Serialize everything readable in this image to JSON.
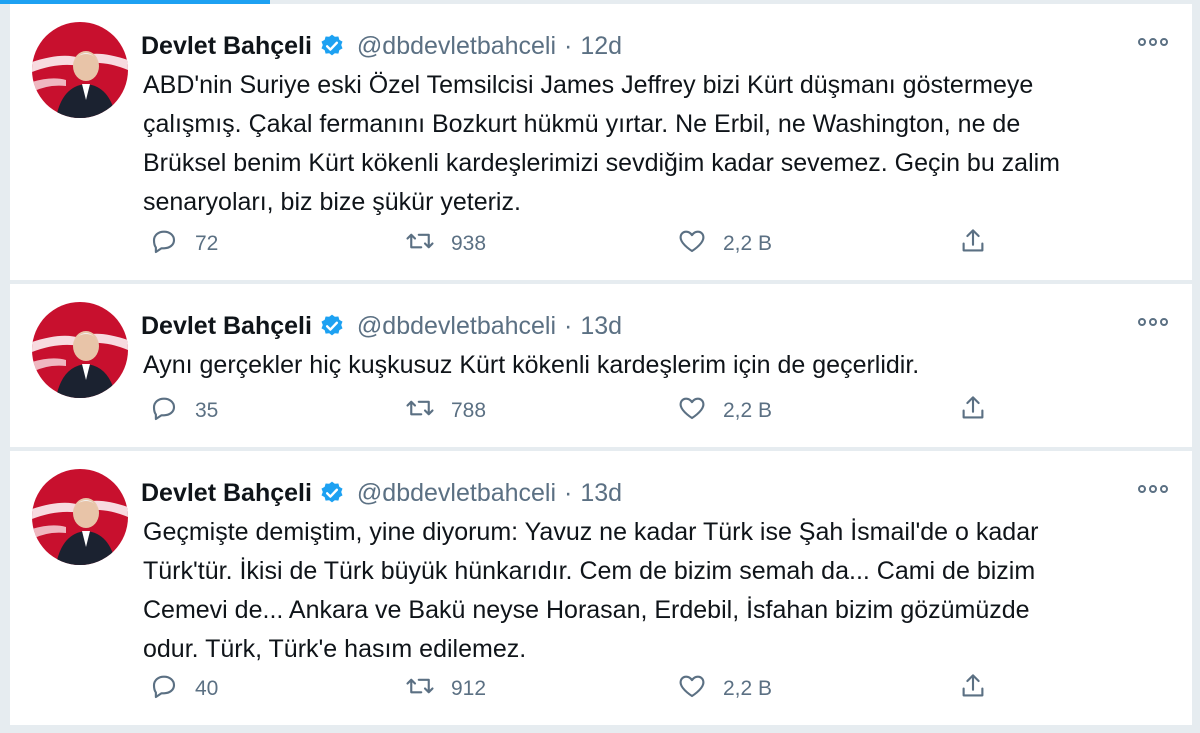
{
  "colors": {
    "accent": "#1da1f2",
    "verified": "#1da1f2",
    "secondary_text": "#5b7083",
    "avatar_bg": "#c8102e"
  },
  "icons": {
    "reply": "reply-icon",
    "retweet": "retweet-icon",
    "like": "heart-icon",
    "share": "share-icon",
    "verified": "verified-badge-icon",
    "more": "more-icon"
  },
  "tweets": [
    {
      "name": "Devlet Bahçeli",
      "handle": "@dbdevletbahceli",
      "dot": "·",
      "time": "12d",
      "text": "ABD'nin Suriye eski Özel Temsilcisi James Jeffrey bizi Kürt düşmanı göstermeye\nçalışmış. Çakal fermanını Bozkurt hükmü yırtar. Ne Erbil, ne Washington, ne de\nBrüksel benim Kürt kökenli kardeşlerimizi sevdiğim kadar sevemez. Geçin bu zalim\nsenaryoları, biz bize şükür yeteriz.",
      "replies": "72",
      "retweets": "938",
      "likes": "2,2 B"
    },
    {
      "name": "Devlet Bahçeli",
      "handle": "@dbdevletbahceli",
      "dot": "·",
      "time": "13d",
      "text": "Aynı gerçekler hiç kuşkusuz Kürt kökenli kardeşlerim için de geçerlidir.",
      "replies": "35",
      "retweets": "788",
      "likes": "2,2 B"
    },
    {
      "name": "Devlet Bahçeli",
      "handle": "@dbdevletbahceli",
      "dot": "·",
      "time": "13d",
      "text": "Geçmişte demiştim, yine diyorum: Yavuz ne kadar Türk ise Şah İsmail'de o kadar\nTürk'tür. İkisi de Türk büyük hünkarıdır. Cem de bizim semah da... Cami de bizim\nCemevi de... Ankara ve Bakü neyse Horasan, Erdebil, İsfahan bizim gözümüzde\nodur. Türk, Türk'e hasım edilemez.",
      "replies": "40",
      "retweets": "912",
      "likes": "2,2 B"
    }
  ]
}
